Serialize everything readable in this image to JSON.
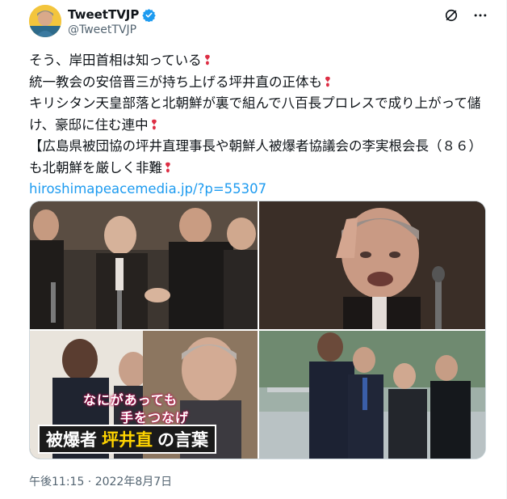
{
  "author": {
    "display_name": "TweetTVJP",
    "handle": "@TweetTVJP"
  },
  "tweet": {
    "lines": [
      "そう、岸田首相は知っている",
      "統一教会の安倍晋三が持ち上げる坪井直の正体も",
      "キリシタン天皇部落と北朝鮮が裏で組んで八百長プロレスで成り上がって儲け、豪邸に住む連中",
      "【広島県被団協の坪井直理事長や朝鮮人被爆者協議会の李実根会長（８６）も北朝鮮を厳しく非難"
    ],
    "link": "hiroshimapeacemedia.jp/?p=55307",
    "heart_glyph": "❢"
  },
  "media": {
    "overlay_line1": "なにがあっても",
    "overlay_line2": "手をつなげ",
    "banner_white_1": "被爆者",
    "banner_yellow": "坪井直",
    "banner_white_2": "の言葉"
  },
  "timestamp": "午後11:15 · 2022年8月7日",
  "colors": {
    "link": "#1d9bf0",
    "verified": "#1d9bf0",
    "heart": "#dd2e44",
    "banner_yellow": "#ffd400"
  },
  "icons": [
    "verified-badge-icon",
    "grok-icon",
    "more-icon"
  ]
}
